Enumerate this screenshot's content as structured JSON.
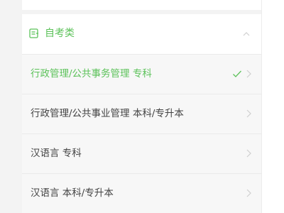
{
  "category": {
    "title": "自考类",
    "icon": "document-icon",
    "expanded": true,
    "accent_color": "#5cc25a"
  },
  "options": [
    {
      "label": "行政管理/公共事务管理 专科",
      "selected": true
    },
    {
      "label": "行政管理/公共事业管理 本科/专升本",
      "selected": false
    },
    {
      "label": "汉语言 专科",
      "selected": false
    },
    {
      "label": "汉语言 本科/专升本",
      "selected": false
    }
  ]
}
